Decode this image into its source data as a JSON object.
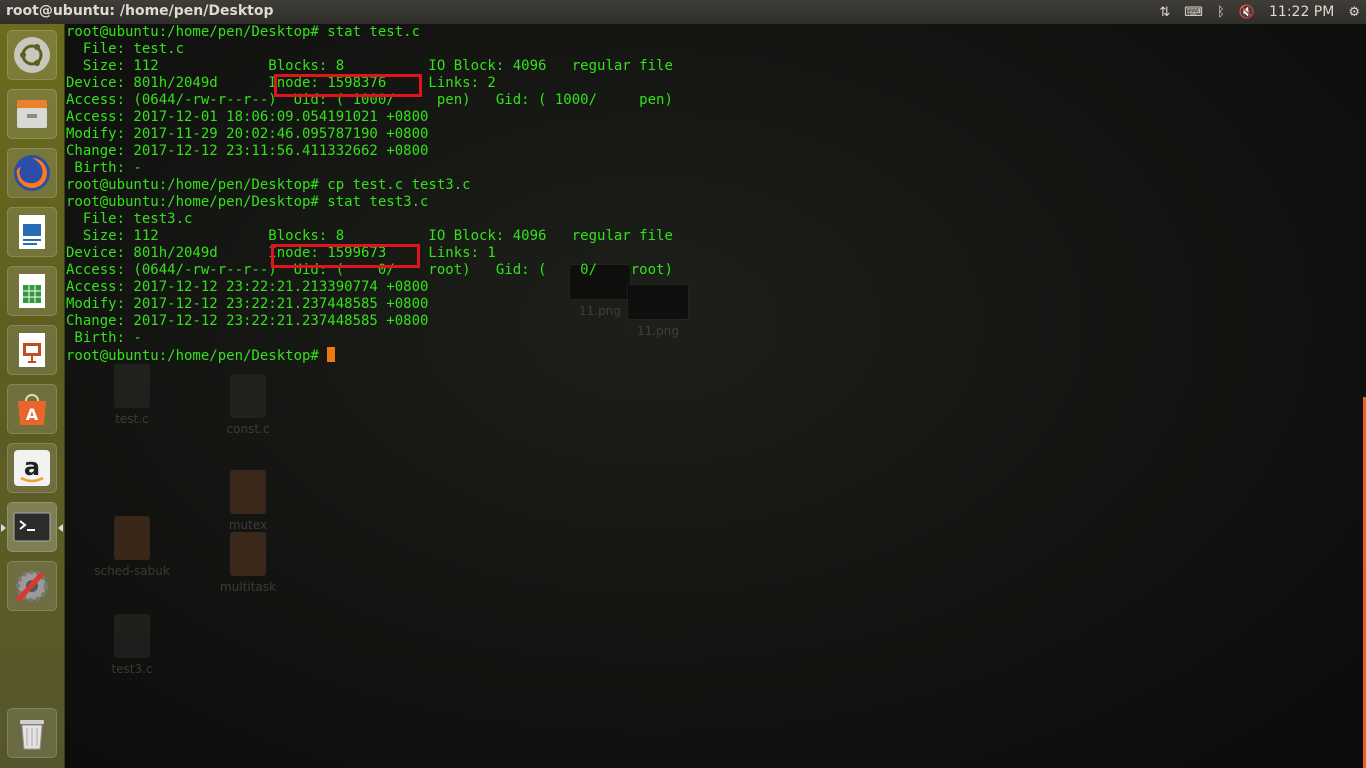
{
  "window_title": "root@ubuntu: /home/pen/Desktop",
  "panel": {
    "indicators": [
      {
        "icon": "network-updown-icon",
        "glyph": "⇅"
      },
      {
        "icon": "keyboard-icon",
        "glyph": "⌨"
      },
      {
        "icon": "bluetooth-icon",
        "glyph": "ᛒ"
      },
      {
        "icon": "volume-muted-icon",
        "glyph": "🔇"
      }
    ],
    "clock": "11:22 PM",
    "settings_icon": "gear-icon",
    "settings_glyph": "⚙"
  },
  "launcher": {
    "items": [
      {
        "name": "ubuntu-dash",
        "icon": "ubuntu-logo-icon",
        "color": "#e95420"
      },
      {
        "name": "files",
        "icon": "file-manager-icon",
        "color": "#8d8d86"
      },
      {
        "name": "firefox",
        "icon": "firefox-icon",
        "color": "#ff8a1a"
      },
      {
        "name": "libreoffice-writer",
        "icon": "writer-icon",
        "color": "#2a6db3"
      },
      {
        "name": "libreoffice-calc",
        "icon": "calc-icon",
        "color": "#2f9b3a"
      },
      {
        "name": "libreoffice-impress",
        "icon": "impress-icon",
        "color": "#c24b1f"
      },
      {
        "name": "software-center",
        "icon": "software-center-icon",
        "color": "#e8662c"
      },
      {
        "name": "amazon",
        "icon": "amazon-icon",
        "color": "#f0a030"
      },
      {
        "name": "terminal",
        "icon": "terminal-icon",
        "color": "#2c2c2c",
        "active": true
      },
      {
        "name": "system-settings",
        "icon": "system-settings-icon",
        "color": "#9a9a9a"
      },
      {
        "name": "trash",
        "icon": "trash-icon",
        "color": "#9a9a9a"
      }
    ]
  },
  "desktop_icons": [
    "test.c",
    "const.c",
    "mutex",
    "sched-sabuk",
    "multitask",
    "test3.c",
    "11.png",
    "11.png"
  ],
  "terminal": {
    "lines": [
      "root@ubuntu:/home/pen/Desktop# stat test.c",
      "  File: test.c",
      "  Size: 112             Blocks: 8          IO Block: 4096   regular file",
      "Device: 801h/2049d      Inode: 1598376     Links: 2",
      "Access: (0644/-rw-r--r--)  Uid: ( 1000/     pen)   Gid: ( 1000/     pen)",
      "Access: 2017-12-01 18:06:09.054191021 +0800",
      "Modify: 2017-11-29 20:02:46.095787190 +0800",
      "Change: 2017-12-12 23:11:56.411332662 +0800",
      " Birth: -",
      "root@ubuntu:/home/pen/Desktop# cp test.c test3.c",
      "root@ubuntu:/home/pen/Desktop# stat test3.c",
      "  File: test3.c",
      "  Size: 112             Blocks: 8          IO Block: 4096   regular file",
      "Device: 801h/2049d      Inode: 1599673     Links: 1",
      "Access: (0644/-rw-r--r--)  Uid: (    0/    root)   Gid: (    0/    root)",
      "Access: 2017-12-12 23:22:21.213390774 +0800",
      "Modify: 2017-12-12 23:22:21.237448585 +0800",
      "Change: 2017-12-12 23:22:21.237448585 +0800",
      " Birth: -"
    ],
    "prompt": "root@ubuntu:/home/pen/Desktop# ",
    "text_color": "#33e21a",
    "cursor_color": "#ee7a0f",
    "highlight_color": "#e0141b"
  }
}
